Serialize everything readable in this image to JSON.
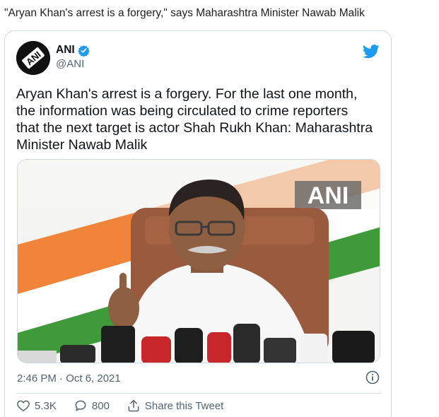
{
  "headline": "\"Aryan Khan's arrest is a forgery,\" says Maharashtra Minister Nawab Malik",
  "tweet": {
    "display_name": "ANI",
    "handle": "@ANI",
    "avatar_text": "ANI",
    "text": "Aryan Khan's arrest is a forgery. For the last one month,\nthe information was being circulated to crime reporters\nthat the next target is actor Shah Rukh Khan: Maharashtra\nMinister Nawab Malik",
    "media_watermark": "ANI",
    "timestamp": "2:46 PM · Oct 6, 2021",
    "actions": {
      "likes": "5.3K",
      "replies": "800",
      "share_label": "Share this Tweet"
    }
  },
  "colors": {
    "twitter_blue": "#1d9bf0",
    "secondary_text": "#536471",
    "border": "#cfd9de"
  },
  "icons": [
    "verified-badge-icon",
    "twitter-bird-icon",
    "info-icon",
    "heart-icon",
    "reply-icon",
    "share-icon"
  ]
}
